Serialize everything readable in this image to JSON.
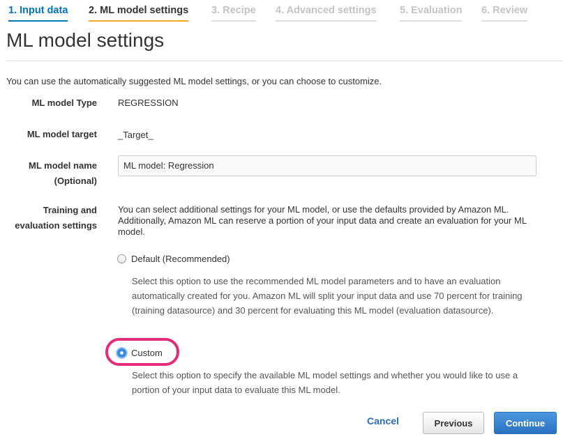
{
  "steps": [
    {
      "label": "1. Input data",
      "state": "done"
    },
    {
      "label": "2. ML model settings",
      "state": "active"
    },
    {
      "label": "3. Recipe",
      "state": "future"
    },
    {
      "label": "4. Advanced settings",
      "state": "future"
    },
    {
      "label": "5. Evaluation",
      "state": "future"
    },
    {
      "label": "6. Review",
      "state": "future"
    }
  ],
  "page_title": "ML model settings",
  "intro": "You can use the automatically suggested ML model settings, or you can choose to customize.",
  "fields": {
    "model_type": {
      "label": "ML model Type",
      "value": "REGRESSION"
    },
    "model_target": {
      "label": "ML model target",
      "value": "_Target_"
    },
    "model_name": {
      "label": "ML model name",
      "label_sub": "(Optional)",
      "value": "ML model: Regression"
    },
    "training": {
      "label": "Training and",
      "label_sub": "evaluation settings",
      "description": "You can select additional settings for your ML model, or use the defaults provided by Amazon ML. Additionally, Amazon ML can reserve a portion of your input data and create an evaluation for your ML model."
    }
  },
  "options": {
    "default": {
      "label": "Default (Recommended)",
      "selected": false,
      "description": "Select this option to use the recommended ML model parameters and to have an evaluation automatically created for you. Amazon ML will split your input data and use 70 percent for training (training datasource) and 30 percent for evaluating this ML model (evaluation datasource)."
    },
    "custom": {
      "label": "Custom",
      "selected": true,
      "description": "Select this option to specify the available ML model settings and whether you would like to use a portion of your input data to evaluate this ML model."
    }
  },
  "buttons": {
    "cancel": "Cancel",
    "previous": "Previous",
    "continue": "Continue"
  },
  "colors": {
    "link": "#0073bb",
    "active_step_underline": "#f0a830",
    "primary_button": "#2a72c0",
    "highlight_ring": "#e42c78"
  }
}
